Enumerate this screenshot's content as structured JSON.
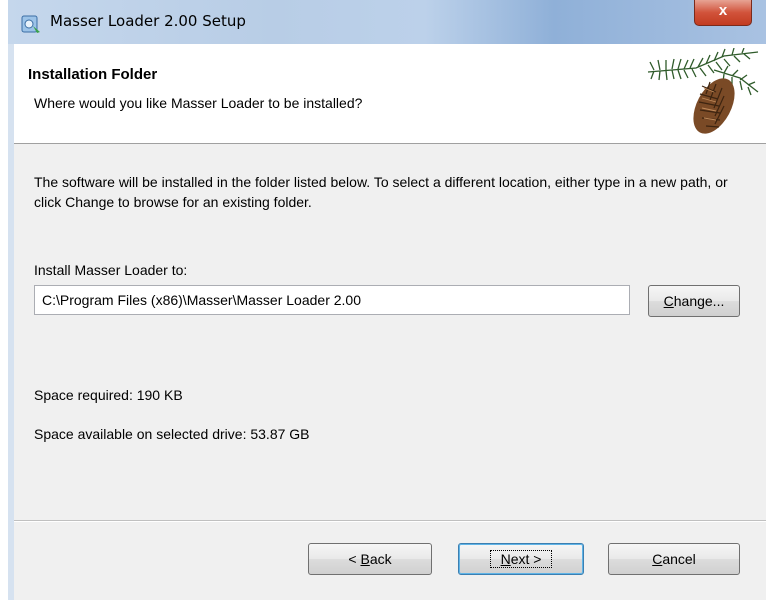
{
  "window": {
    "title": "Masser Loader 2.00 Setup",
    "close_glyph": "x"
  },
  "header": {
    "title": "Installation Folder",
    "subtitle": "Where would you like Masser Loader to be installed?",
    "logo": "pine-cone-logo"
  },
  "body": {
    "description": "The software will be installed in the folder listed below. To select a different location, either type in a new path, or click Change to browse for an existing folder.",
    "install_label": "Install Masser Loader to:",
    "install_path": "C:\\Program Files (x86)\\Masser\\Masser Loader 2.00",
    "change_button": {
      "accel": "C",
      "rest": "hange..."
    },
    "space_required": "Space required: 190 KB",
    "space_available": "Space available on selected drive: 53.87 GB"
  },
  "footer": {
    "back_button": {
      "prefix": "< ",
      "accel": "B",
      "rest": "ack"
    },
    "next_button": {
      "accel": "N",
      "rest": "ext >"
    },
    "cancel_button": {
      "accel": "C",
      "rest": "ancel"
    }
  },
  "icons": {
    "app": "setup-installer-icon",
    "close": "close-icon"
  },
  "colors": {
    "title_bar": "#b8cde6",
    "close_button": "#c94a30",
    "dialog_bg": "#f0f0f0",
    "default_button_border": "#3c7fb1"
  }
}
